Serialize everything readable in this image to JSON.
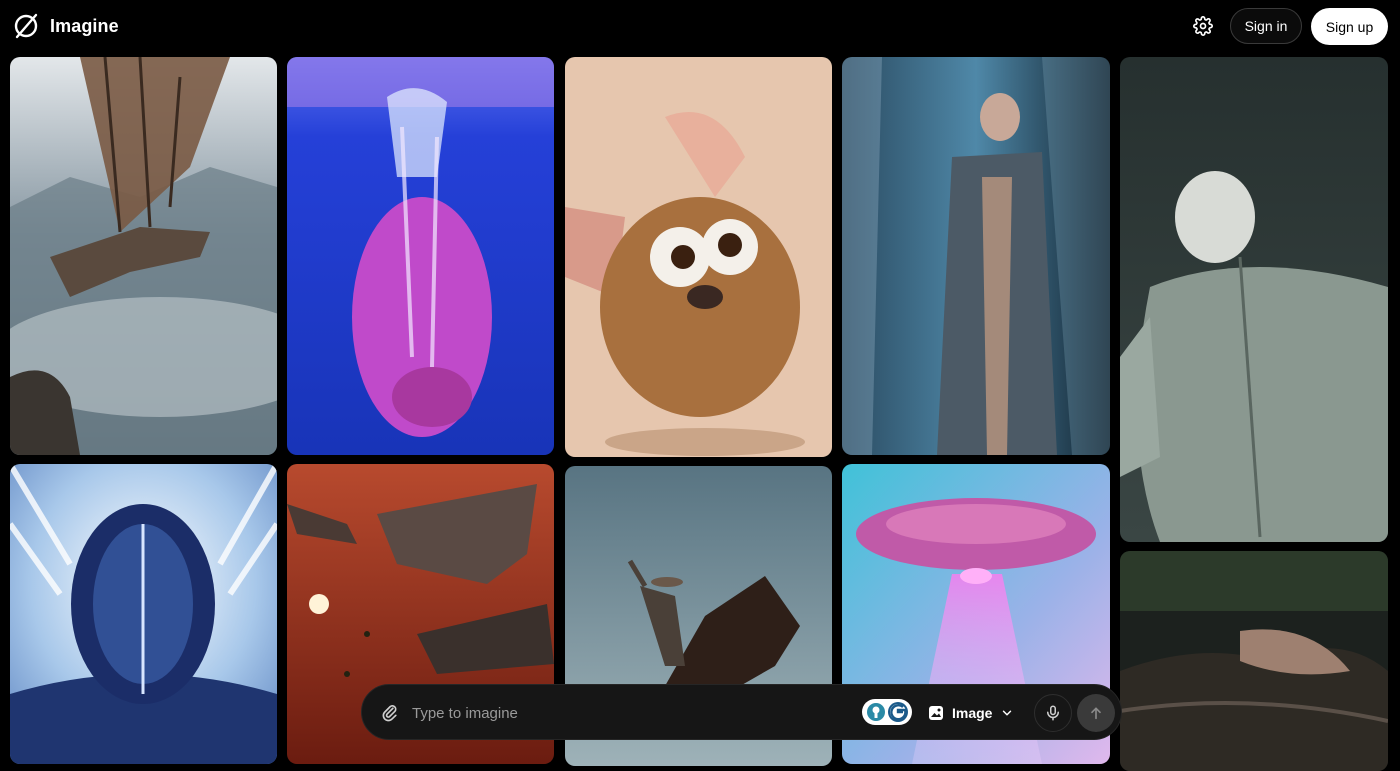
{
  "app": {
    "name": "Imagine",
    "logo_icon": "slashed-circle-logo-icon"
  },
  "header": {
    "settings_icon": "gear-icon",
    "sign_in_label": "Sign in",
    "sign_up_label": "Sign up"
  },
  "gallery": {
    "tiles": [
      {
        "subject": "dragon flying over misty mountains",
        "colors": [
          "#c9d3d8",
          "#7a8c98"
        ]
      },
      {
        "subject": "pink bear diving underwater",
        "colors": [
          "#2c45c8",
          "#1430b0"
        ]
      },
      {
        "subject": "fluffy cartoon creature with big ears",
        "colors": [
          "#e6c9b2",
          "#caa386"
        ]
      },
      {
        "subject": "man in trench coat behind plastic curtains",
        "colors": [
          "#3c6a85",
          "#0f1e2a"
        ]
      },
      {
        "subject": "figure in grey zip jacket leaning back",
        "colors": [
          "#2a3338",
          "#8fa19a"
        ]
      },
      {
        "subject": "futuristic helmet with light streaks",
        "colors": [
          "#cfe2f5",
          "#1b2f6e"
        ]
      },
      {
        "subject": "spaceships battle in red sky",
        "colors": [
          "#c35a3a",
          "#6e1e10"
        ]
      },
      {
        "subject": "cowboy riding a rearing horse",
        "colors": [
          "#5d7a86",
          "#a9bcc0"
        ]
      },
      {
        "subject": "ufo beaming light",
        "colors": [
          "#4ac3d8",
          "#d8b0e8"
        ]
      },
      {
        "subject": "person lying in dark water",
        "colors": [
          "#1e2420",
          "#6b5a4a"
        ]
      }
    ]
  },
  "prompt": {
    "placeholder": "Type to imagine",
    "value": "",
    "attach_icon": "paperclip-icon",
    "model_icons": [
      "model-a-icon",
      "model-g-icon"
    ],
    "mode_label": "Image",
    "mode_icon": "image-icon",
    "mode_chevron": "chevron-down-icon",
    "mic_icon": "microphone-icon",
    "send_icon": "arrow-up-icon",
    "accent": "#ffffff"
  }
}
